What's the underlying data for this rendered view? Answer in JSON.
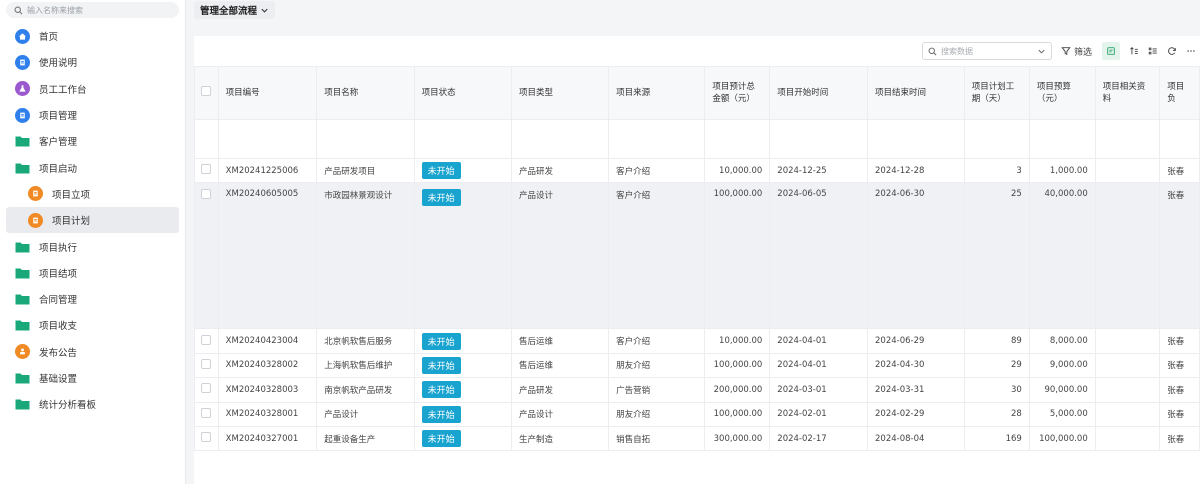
{
  "sidebar": {
    "search_placeholder": "输入名称来搜索",
    "items": [
      {
        "label": "首页",
        "icon": "home-icon",
        "kind": "circle",
        "color": "#2f80ed"
      },
      {
        "label": "使用说明",
        "icon": "document-icon",
        "kind": "circle",
        "color": "#2f80ed"
      },
      {
        "label": "员工工作台",
        "icon": "flask-icon",
        "kind": "circle",
        "color": "#9b59d0"
      },
      {
        "label": "项目管理",
        "icon": "document-icon",
        "kind": "circle",
        "color": "#2f80ed"
      },
      {
        "label": "客户管理",
        "icon": "folder-icon",
        "kind": "folder",
        "color": "#1aa87a"
      },
      {
        "label": "项目启动",
        "icon": "folder-icon",
        "kind": "folder",
        "color": "#1aa87a"
      },
      {
        "label": "项目立项",
        "icon": "document-icon",
        "kind": "circle",
        "color": "#f08a24",
        "sub": true
      },
      {
        "label": "项目计划",
        "icon": "document-icon",
        "kind": "circle",
        "color": "#f08a24",
        "sub": true,
        "active": true
      },
      {
        "label": "项目执行",
        "icon": "folder-icon",
        "kind": "folder",
        "color": "#1aa87a"
      },
      {
        "label": "项目结项",
        "icon": "folder-icon",
        "kind": "folder",
        "color": "#1aa87a"
      },
      {
        "label": "合同管理",
        "icon": "folder-icon",
        "kind": "folder",
        "color": "#1aa87a"
      },
      {
        "label": "项目收支",
        "icon": "folder-icon",
        "kind": "folder",
        "color": "#1aa87a"
      },
      {
        "label": "发布公告",
        "icon": "megaphone-icon",
        "kind": "circle",
        "color": "#f08a24"
      },
      {
        "label": "基础设置",
        "icon": "folder-icon",
        "kind": "folder",
        "color": "#1aa87a"
      },
      {
        "label": "统计分析看板",
        "icon": "folder-icon",
        "kind": "folder",
        "color": "#1aa87a"
      }
    ]
  },
  "topbar": {
    "process_label": "管理全部流程"
  },
  "toolbar": {
    "search_placeholder": "搜索数据",
    "filter_label": "筛选"
  },
  "table": {
    "columns": [
      "项目编号",
      "项目名称",
      "项目状态",
      "项目类型",
      "项目来源",
      "项目预计总金额（元）",
      "项目开始时间",
      "项目结束时间",
      "项目计划工期（天）",
      "项目预算（元）",
      "项目相关资料",
      "项目负"
    ],
    "rows": [
      {
        "id": "XM20241225006",
        "name": "产品研发项目",
        "status": "未开始",
        "type": "产品研发",
        "source": "客户介绍",
        "amount": "10,000.00",
        "start": "2024-12-25",
        "end": "2024-12-28",
        "days": "3",
        "budget": "1,000.00",
        "docs": "",
        "owner": "张春"
      },
      {
        "id": "XM20240605005",
        "name": "市政园林景观设计",
        "status": "未开始",
        "type": "产品设计",
        "source": "客户介绍",
        "amount": "100,000.00",
        "start": "2024-06-05",
        "end": "2024-06-30",
        "days": "25",
        "budget": "40,000.00",
        "docs": "",
        "owner": "张春",
        "tall": true
      },
      {
        "id": "XM20240423004",
        "name": "北京帆软售后服务",
        "status": "未开始",
        "type": "售后运维",
        "source": "客户介绍",
        "amount": "10,000.00",
        "start": "2024-04-01",
        "end": "2024-06-29",
        "days": "89",
        "budget": "8,000.00",
        "docs": "",
        "owner": "张春"
      },
      {
        "id": "XM20240328002",
        "name": "上海帆软售后维护",
        "status": "未开始",
        "type": "售后运维",
        "source": "朋友介绍",
        "amount": "100,000.00",
        "start": "2024-04-01",
        "end": "2024-04-30",
        "days": "29",
        "budget": "9,000.00",
        "docs": "",
        "owner": "张春"
      },
      {
        "id": "XM20240328003",
        "name": "南京帆软产品研发",
        "status": "未开始",
        "type": "产品研发",
        "source": "广告营销",
        "amount": "200,000.00",
        "start": "2024-03-01",
        "end": "2024-03-31",
        "days": "30",
        "budget": "90,000.00",
        "docs": "",
        "owner": "张春"
      },
      {
        "id": "XM20240328001",
        "name": "产品设计",
        "status": "未开始",
        "type": "产品设计",
        "source": "朋友介绍",
        "amount": "100,000.00",
        "start": "2024-02-01",
        "end": "2024-02-29",
        "days": "28",
        "budget": "5,000.00",
        "docs": "",
        "owner": "张春"
      },
      {
        "id": "XM20240327001",
        "name": "起重设备生产",
        "status": "未开始",
        "type": "生产制造",
        "source": "销售自拓",
        "amount": "300,000.00",
        "start": "2024-02-17",
        "end": "2024-08-04",
        "days": "169",
        "budget": "100,000.00",
        "docs": "",
        "owner": "张春"
      }
    ]
  },
  "colors": {
    "accent": "#2aa36b",
    "status_badge": "#19a3cf",
    "folder": "#1aa87a"
  }
}
